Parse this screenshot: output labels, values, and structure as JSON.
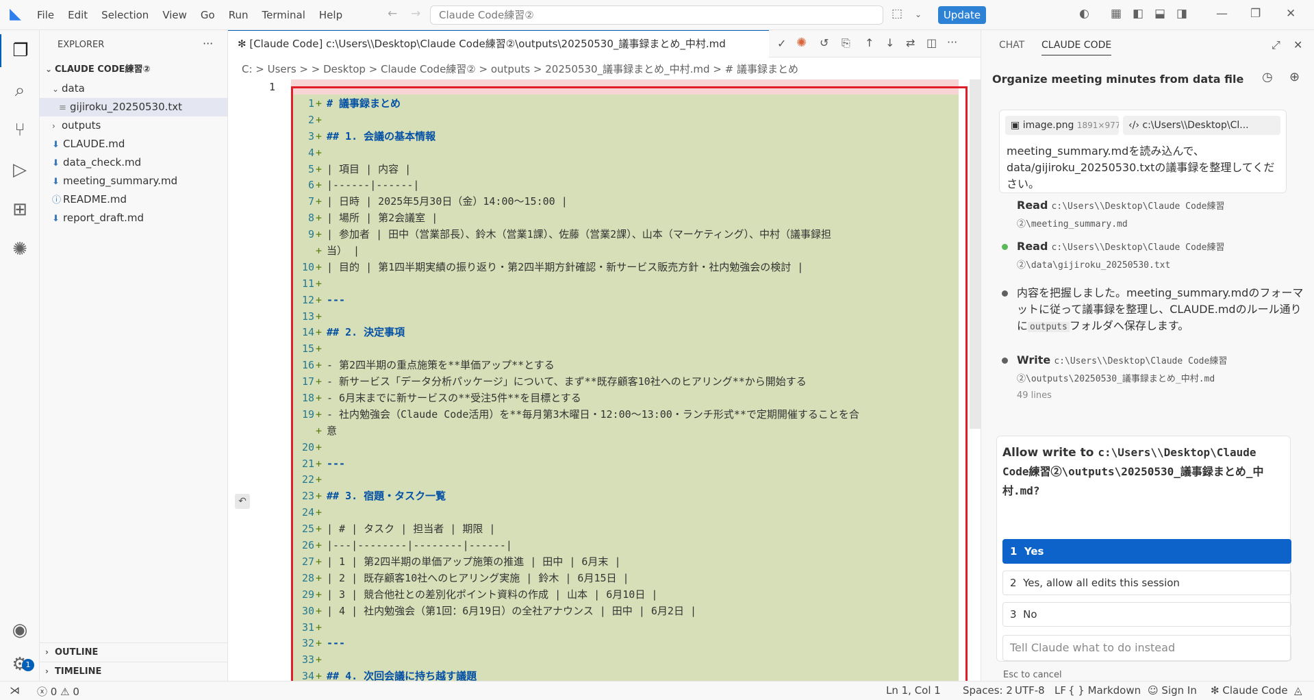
{
  "titlebar": {
    "menu": [
      "File",
      "Edit",
      "Selection",
      "View",
      "Go",
      "Run",
      "Terminal",
      "Help"
    ],
    "search": "Claude Code練習②",
    "update": "Update"
  },
  "explorer": {
    "title": "EXPLORER",
    "root": "CLAUDE CODE練習②",
    "items": [
      "data",
      "gijiroku_20250530.txt",
      "outputs",
      "CLAUDE.md",
      "data_check.md",
      "meeting_summary.md",
      "README.md",
      "report_draft.md"
    ],
    "outline": "OUTLINE",
    "timeline": "TIMELINE"
  },
  "editor": {
    "tab": "✻ [Claude Code] c:\\Users\\\\Desktop\\Claude Code練習②\\outputs\\20250530_議事録まとめ_中村.md",
    "breadcrumb": "C: > Users >  > Desktop > Claude Code練習② > outputs > 20250530_議事録まとめ_中村.md > # 議事録まとめ",
    "top_line_number": "1",
    "lines": [
      {
        "n": "1",
        "t": "# 議事録まとめ",
        "h": true
      },
      {
        "n": "2",
        "t": ""
      },
      {
        "n": "3",
        "t": "## 1. 会議の基本情報",
        "h": true
      },
      {
        "n": "4",
        "t": ""
      },
      {
        "n": "5",
        "t": "| 項目 | 内容 |"
      },
      {
        "n": "6",
        "t": "|------|------|"
      },
      {
        "n": "7",
        "t": "| 日時 | 2025年5月30日（金）14:00～15:00 |"
      },
      {
        "n": "8",
        "t": "| 場所 | 第2会議室 |"
      },
      {
        "n": "9",
        "t": "| 参加者 | 田中（営業部長）、鈴木（営業1課）、佐藤（営業2課）、山本（マーケティング）、中村（議事録担"
      },
      {
        "n": "",
        "t": "当） |"
      },
      {
        "n": "10",
        "t": "| 目的 | 第1四半期実績の振り返り・第2四半期方針確認・新サービス販売方針・社内勉強会の検討 |"
      },
      {
        "n": "11",
        "t": ""
      },
      {
        "n": "12",
        "t": "---",
        "h": true
      },
      {
        "n": "13",
        "t": ""
      },
      {
        "n": "14",
        "t": "## 2. 決定事項",
        "h": true
      },
      {
        "n": "15",
        "t": ""
      },
      {
        "n": "16",
        "t": "- 第2四半期の重点施策を**単価アップ**とする"
      },
      {
        "n": "17",
        "t": "- 新サービス「データ分析パッケージ」について、まず**既存顧客10社へのヒアリング**から開始する"
      },
      {
        "n": "18",
        "t": "- 6月末までに新サービスの**受注5件**を目標とする"
      },
      {
        "n": "19",
        "t": "- 社内勉強会（Claude Code活用）を**毎月第3木曜日・12:00～13:00・ランチ形式**で定期開催することを合"
      },
      {
        "n": "",
        "t": "意"
      },
      {
        "n": "20",
        "t": ""
      },
      {
        "n": "21",
        "t": "---",
        "h": true
      },
      {
        "n": "22",
        "t": ""
      },
      {
        "n": "23",
        "t": "## 3. 宿題・タスク一覧",
        "h": true
      },
      {
        "n": "24",
        "t": ""
      },
      {
        "n": "25",
        "t": "| # | タスク | 担当者 | 期限 |"
      },
      {
        "n": "26",
        "t": "|---|--------|--------|------|"
      },
      {
        "n": "27",
        "t": "| 1 | 第2四半期の単価アップ施策の推進 | 田中 | 6月末 |"
      },
      {
        "n": "28",
        "t": "| 2 | 既存顧客10社へのヒアリング実施 | 鈴木 | 6月15日 |"
      },
      {
        "n": "29",
        "t": "| 3 | 競合他社との差別化ポイント資料の作成 | 山本 | 6月10日 |"
      },
      {
        "n": "30",
        "t": "| 4 | 社内勉強会（第1回：6月19日）の全社アナウンス | 田中 | 6月2日 |"
      },
      {
        "n": "31",
        "t": ""
      },
      {
        "n": "32",
        "t": "---",
        "h": true
      },
      {
        "n": "33",
        "t": ""
      },
      {
        "n": "34",
        "t": "## 4. 次回会議に持ち越す議題",
        "h": true
      }
    ]
  },
  "panel": {
    "tab_chat": "CHAT",
    "tab_claude": "CLAUDE CODE",
    "title": "Organize meeting minutes from data file",
    "chip_image": "image.png",
    "chip_image_size": "1891×977",
    "chip_path": "c:\\Users\\\\Desktop\\Cl...",
    "message": "meeting_summary.mdを読み込んで、data/gijiroku_20250530.txtの議事録を整理してください。",
    "step1_kw": "Read",
    "step1_path": "c:\\Users\\\\Desktop\\Claude Code練習②\\meeting_summary.md",
    "step2_kw": "Read",
    "step2_path": "c:\\Users\\\\Desktop\\Claude Code練習②\\data\\gijiroku_20250530.txt",
    "step3_a": "内容を把握しました。meeting_summary.mdのフォーマットに従って議事録を整理し、CLAUDE.mdのルール通りに",
    "step3_code": "outputs",
    "step3_b": "フォルダへ保存します。",
    "step4_kw": "Write",
    "step4_path": "c:\\Users\\\\Desktop\\Claude Code練習②\\outputs\\20250530_議事録まとめ_中村.md",
    "step4_lines": "49 lines",
    "perm_q_prefix": "Allow write to",
    "perm_q_path": "c:\\Users\\\\Desktop\\Claude Code練習②\\outputs\\20250530_議事録まとめ_中村.md?",
    "opt1_n": "1",
    "opt1": "Yes",
    "opt2_n": "2",
    "opt2": "Yes, allow all edits this session",
    "opt3_n": "3",
    "opt3": "No",
    "instead": "Tell Claude what to do instead",
    "esc": "Esc to cancel"
  },
  "status": {
    "errors": "0",
    "warnings": "0",
    "position": "Ln 1, Col 1",
    "spaces": "Spaces: 2",
    "encoding": "UTF-8",
    "eol": "LF",
    "language": "Markdown",
    "signin": "Sign In",
    "claude": "Claude Code"
  },
  "badge": "1"
}
